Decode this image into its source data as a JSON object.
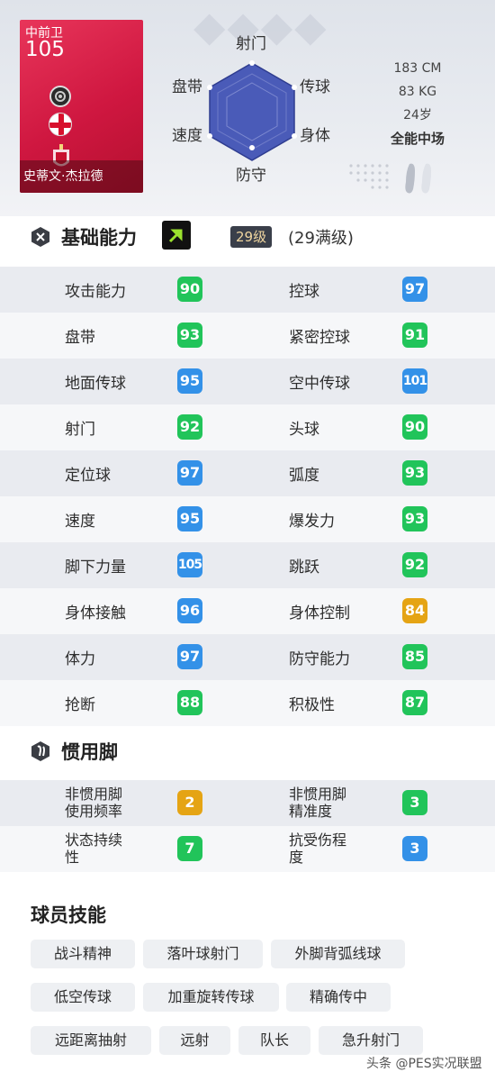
{
  "player": {
    "position": "中前卫",
    "rating": "105",
    "name": "史蒂文·杰拉德",
    "height": "183 CM",
    "weight": "83 KG",
    "age": "24岁",
    "playstyle": "全能中场"
  },
  "radar": {
    "labels": {
      "top": "射门",
      "top_right": "传球",
      "bottom_right": "身体",
      "bottom": "防守",
      "bottom_left": "速度",
      "top_left": "盘带"
    },
    "fill_color": "#4a5bb8"
  },
  "basic": {
    "title": "基础能力",
    "level": "29级",
    "max_level": "(29满级)",
    "stats": [
      {
        "left_label": "攻击能力",
        "left_value": "90",
        "left_color": "#21c45a",
        "right_label": "控球",
        "right_value": "97",
        "right_color": "#3391e8"
      },
      {
        "left_label": "盘带",
        "left_value": "93",
        "left_color": "#21c45a",
        "right_label": "紧密控球",
        "right_value": "91",
        "right_color": "#21c45a"
      },
      {
        "left_label": "地面传球",
        "left_value": "95",
        "left_color": "#3391e8",
        "right_label": "空中传球",
        "right_value": "101",
        "right_color": "#3391e8"
      },
      {
        "left_label": "射门",
        "left_value": "92",
        "left_color": "#21c45a",
        "right_label": "头球",
        "right_value": "90",
        "right_color": "#21c45a"
      },
      {
        "left_label": "定位球",
        "left_value": "97",
        "left_color": "#3391e8",
        "right_label": "弧度",
        "right_value": "93",
        "right_color": "#21c45a"
      },
      {
        "left_label": "速度",
        "left_value": "95",
        "left_color": "#3391e8",
        "right_label": "爆发力",
        "right_value": "93",
        "right_color": "#21c45a"
      },
      {
        "left_label": "脚下力量",
        "left_value": "105",
        "left_color": "#3391e8",
        "right_label": "跳跃",
        "right_value": "92",
        "right_color": "#21c45a"
      },
      {
        "left_label": "身体接触",
        "left_value": "96",
        "left_color": "#3391e8",
        "right_label": "身体控制",
        "right_value": "84",
        "right_color": "#e5a414"
      },
      {
        "left_label": "体力",
        "left_value": "97",
        "left_color": "#3391e8",
        "right_label": "防守能力",
        "right_value": "85",
        "right_color": "#21c45a"
      },
      {
        "left_label": "抢断",
        "left_value": "88",
        "left_color": "#21c45a",
        "right_label": "积极性",
        "right_value": "87",
        "right_color": "#21c45a"
      }
    ]
  },
  "foot": {
    "title": "惯用脚",
    "stats": [
      {
        "left_label_1": "非惯用脚",
        "left_label_2": "使用频率",
        "left_value": "2",
        "left_color": "#e5a414",
        "right_label_1": "非惯用脚",
        "right_label_2": "精准度",
        "right_value": "3",
        "right_color": "#21c45a"
      },
      {
        "left_label_1": "状态持续",
        "left_label_2": "性",
        "left_value": "7",
        "left_color": "#21c45a",
        "right_label_1": "抗受伤程",
        "right_label_2": "度",
        "right_value": "3",
        "right_color": "#3391e8"
      }
    ]
  },
  "skills": {
    "title": "球员技能",
    "items": [
      "战斗精神",
      "落叶球射门",
      "外脚背弧线球",
      "低空传球",
      "加重旋转传球",
      "精确传中",
      "远距离抽射",
      "远射",
      "队长",
      "急升射门"
    ]
  },
  "watermark": "头条 @PES实况联盟"
}
